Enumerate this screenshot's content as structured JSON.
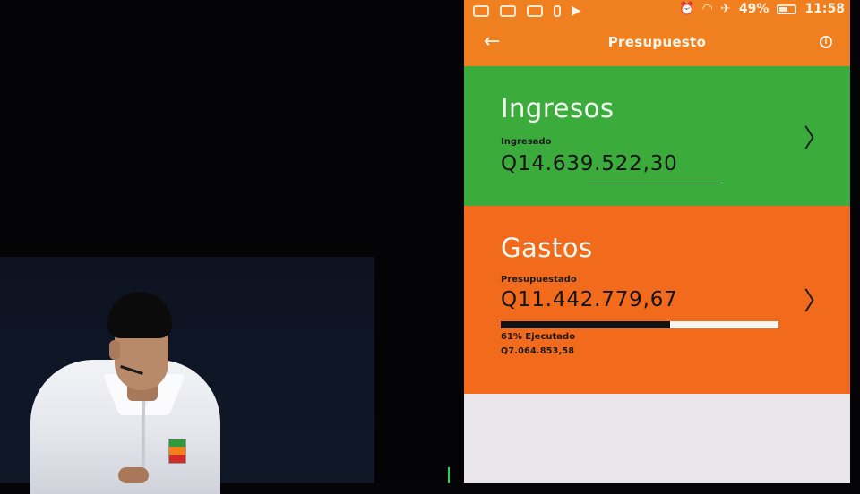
{
  "status_bar": {
    "battery": "49%",
    "time": "11:58",
    "icons": [
      "notification-icon",
      "message-icon",
      "voicemail-icon",
      "usb-icon",
      "play-store-icon",
      "alarm-icon",
      "wifi-icon",
      "airplane-icon",
      "battery-icon"
    ]
  },
  "app_bar": {
    "title": "Presupuesto",
    "back_icon": "arrow-left-icon",
    "info_icon": "info-icon"
  },
  "ingresos": {
    "title": "Ingresos",
    "sub_label": "Ingresado",
    "amount": "Q14.639.522,30"
  },
  "gastos": {
    "title": "Gastos",
    "sub_label": "Presupuestado",
    "amount": "Q11.442.779,67",
    "executed_label": "61% Ejecutado",
    "executed_fraction": 0.61,
    "executed_amount": "Q7.064.853,58"
  },
  "colors": {
    "app_bar": "#f0801f",
    "ingresos_card": "#3bab3c",
    "gastos_card": "#f26a1c"
  }
}
